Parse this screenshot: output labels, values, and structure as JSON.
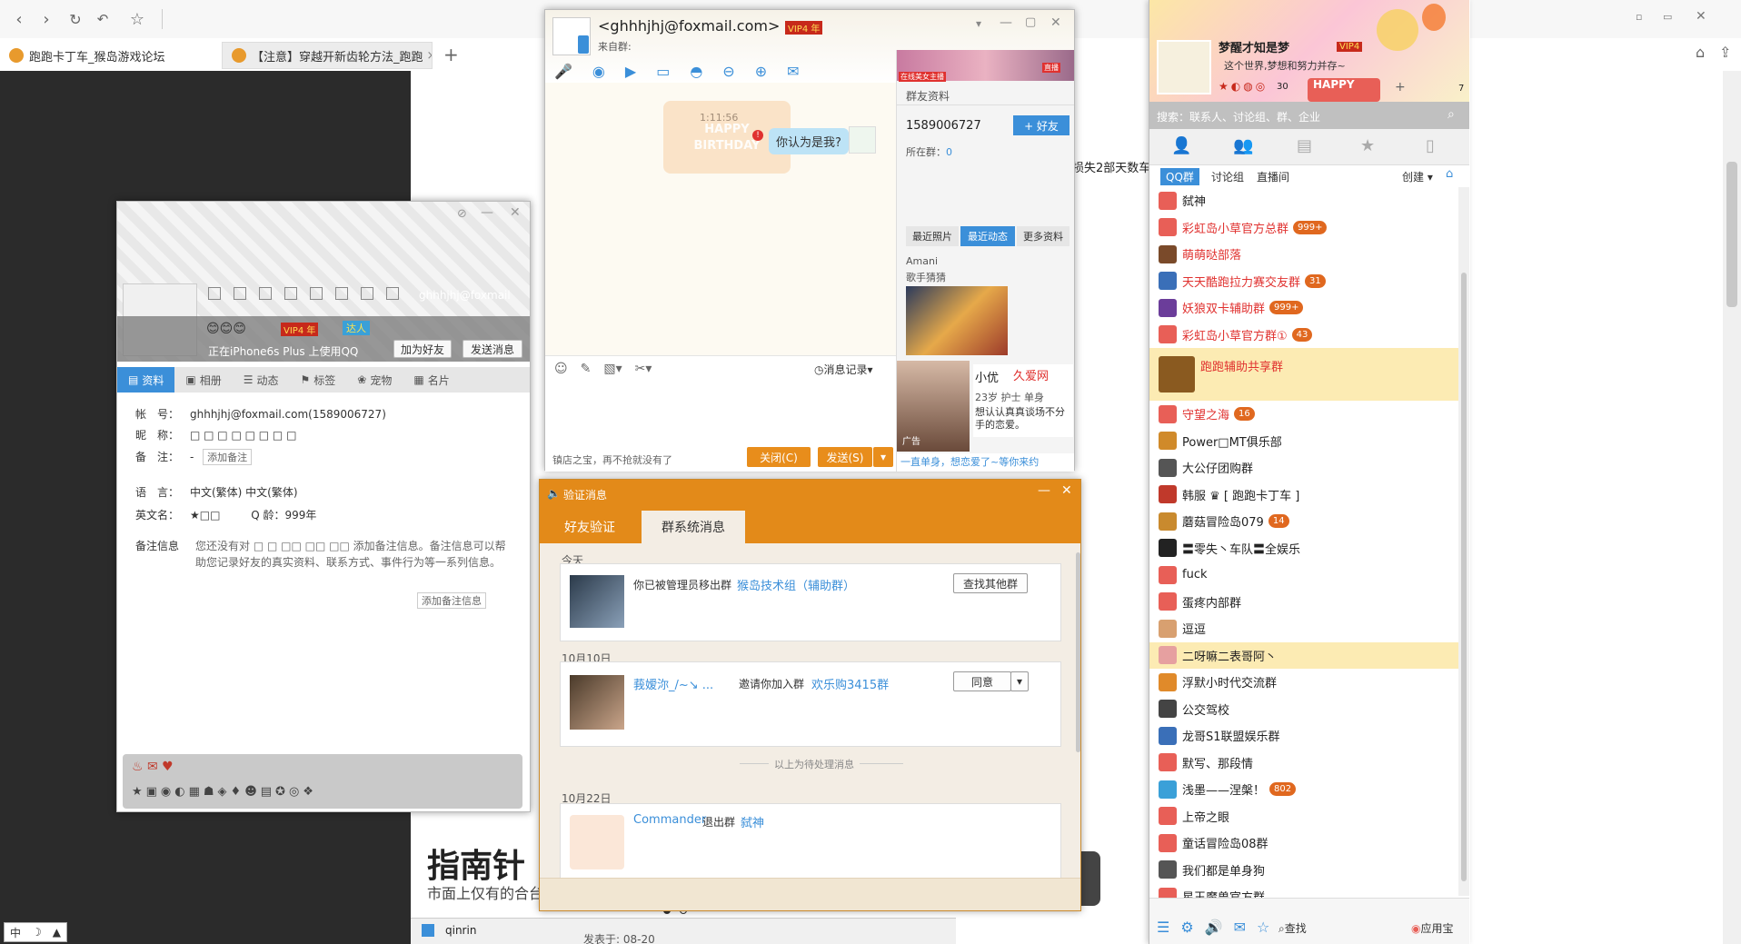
{
  "browser": {
    "tabs": [
      {
        "label": "跑跑卡丁车_猴岛游戏论坛"
      },
      {
        "label": "【注意】穿越开新齿轮方法_跑跑"
      }
    ],
    "new_tab": "+"
  },
  "webpage": {
    "fragment_text": "损失2部天数车",
    "headline": "指南针",
    "subline": "市面上仅有的合台",
    "footer_user": "qinrin",
    "footer_date": "发表于: 08-20"
  },
  "profile": {
    "email_short": "ghhhjhj@foxmail",
    "status": "正在iPhone6s Plus 上使用QQ",
    "vip_badge": "VIP4 年",
    "talent_badge": "达人",
    "add_friend": "加为好友",
    "send_msg": "发送消息",
    "tabs": [
      "资料",
      "相册",
      "动态",
      "标签",
      "宠物",
      "名片"
    ],
    "fields": {
      "account_label": "帐　号：",
      "account_value": "ghhhjhj@foxmail.com(1589006727)",
      "nick_label": "昵　称：",
      "nick_value": "□ □ □ □ □ □ □ □",
      "note_label": "备　注：",
      "note_value": "-",
      "add_note": "添加备注",
      "lang_label": "语　言：",
      "lang_value": "中文(繁体)  中文(繁体)",
      "en_label": "英文名：",
      "en_value": "★□□",
      "qage_label": "Q 龄：",
      "qage_value": "999年",
      "memo_label": "备注信息",
      "memo_text": "您还没有对 □ □ □□ □□ □□ 添加备注信息。备注信息可以帮助您记录好友的真实资料、联系方式、事件行为等一系列信息。",
      "add_memo": "添加备注信息"
    }
  },
  "chat": {
    "title": "<ghhhjhj@foxmail.com>",
    "vip": "VIP4 年",
    "from_group": "来自群:",
    "time": "1:11:56",
    "message": "你认为是我?",
    "history": "消息记录",
    "footer_tip": "镇店之宝，再不抢就没有了",
    "close_btn": "关闭(C)",
    "send_btn": "发送(S)",
    "side_title": "群友资料",
    "qq_number": "1589006727",
    "add_friend": "+ 好友",
    "group_label": "所在群：",
    "group_count": "0",
    "side_tabs": [
      "最近照片",
      "最近动态",
      "更多资料"
    ],
    "poster_name": "Amani",
    "poster_sub": "歌手猜猜",
    "ad_tag": "在线美女主播",
    "ad_name": "小优",
    "ad_brand": "久爱网",
    "ad_info": "23岁 护士 单身",
    "ad_text": "想认认真真谈场不分手的恋爱。",
    "ad_link": "一直单身，想恋爱了~等你来约",
    "ad_label": "广告",
    "ad_live": "直播"
  },
  "verify": {
    "title": "验证消息",
    "tabs": [
      "好友验证",
      "群系统消息"
    ],
    "today": "今天",
    "msg1_text": "你已被管理员移出群",
    "msg1_group": "猴岛技术组（辅助群）",
    "msg1_btn": "查找其他群",
    "date2": "10月10日",
    "msg2_user": "莪嫒沵_/~↘ ...",
    "msg2_text": "邀请你加入群",
    "msg2_group": "欢乐购3415群",
    "msg2_btn": "同意",
    "pending": "以上为待处理消息",
    "date3": "10月22日",
    "msg3_user": "Commander",
    "msg3_text": "退出群",
    "msg3_group": "弑神"
  },
  "qq": {
    "nickname": "梦醒才知是梦",
    "vip": "VIP4",
    "signature": "这个世界,梦想和努力并存~",
    "search_placeholder": "搜索：联系人、讨论组、群、企业",
    "sub_tabs": [
      "QQ群",
      "讨论组",
      "直播间"
    ],
    "create": "创建",
    "level_num": "30",
    "num7": "7",
    "happy": "HAPPY",
    "birthday": "BIRTHDAY",
    "groups": [
      {
        "name": "弑神",
        "badge": "",
        "red": false,
        "color": "#e85f57"
      },
      {
        "name": "彩虹岛小草官方总群",
        "badge": "999+",
        "red": true,
        "color": "#e85f57"
      },
      {
        "name": "萌萌哒部落",
        "badge": "",
        "red": true,
        "color": "#7a4a2a"
      },
      {
        "name": "天天酷跑拉力赛交友群",
        "badge": "31",
        "red": true,
        "color": "#3a6fb8"
      },
      {
        "name": "妖狼双卡辅助群",
        "badge": "999+",
        "red": true,
        "color": "#6b3d9a"
      },
      {
        "name": "彩虹岛小草官方群①",
        "badge": "43",
        "red": true,
        "color": "#e85f57"
      },
      {
        "name": "跑跑辅助共享群",
        "badge": "",
        "red": true,
        "color": "#8a5a20"
      },
      {
        "name": "守望之海",
        "badge": "16",
        "red": true,
        "color": "#e85f57"
      },
      {
        "name": "Power□MT俱乐部",
        "badge": "",
        "red": false,
        "color": "#d08a2a"
      },
      {
        "name": "大公仔团购群",
        "badge": "",
        "red": false,
        "color": "#555"
      },
      {
        "name": "韩服 ♛ [ 跑跑卡丁车 ]",
        "badge": "",
        "red": false,
        "color": "#c0392b"
      },
      {
        "name": "蘑菇冒险岛079",
        "badge": "14",
        "red": false,
        "color": "#c98a2e"
      },
      {
        "name": "〓零失丶车队〓全娱乐",
        "badge": "",
        "red": false,
        "color": "#222"
      },
      {
        "name": "fuck",
        "badge": "",
        "red": false,
        "color": "#e85f57"
      },
      {
        "name": "蛋疼内部群",
        "badge": "",
        "red": false,
        "color": "#e85f57"
      },
      {
        "name": "逗逗",
        "badge": "",
        "red": false,
        "color": "#d8a070"
      },
      {
        "name": "二呀嘛二表哥阿丶",
        "badge": "",
        "red": false,
        "color": "#e6a0a0"
      },
      {
        "name": "浮默小时代交流群",
        "badge": "",
        "red": false,
        "color": "#e08a2a"
      },
      {
        "name": "公交驾校",
        "badge": "",
        "red": false,
        "color": "#444"
      },
      {
        "name": "龙哥S1联盟娱乐群",
        "badge": "",
        "red": false,
        "color": "#3a6fb8"
      },
      {
        "name": "默写、那段情",
        "badge": "",
        "red": false,
        "color": "#e85f57"
      },
      {
        "name": "浅墨——涅槃！",
        "badge": "802",
        "red": false,
        "color": "#3aa0d8"
      },
      {
        "name": "上帝之眼",
        "badge": "",
        "red": false,
        "color": "#e85f57"
      },
      {
        "name": "童话冒险岛08群",
        "badge": "",
        "red": false,
        "color": "#e85f57"
      },
      {
        "name": "我们都是单身狗",
        "badge": "",
        "red": false,
        "color": "#555"
      },
      {
        "name": "星王魔兽官方群",
        "badge": "",
        "red": false,
        "color": "#e85f57"
      }
    ],
    "bottom_find": "查找",
    "bottom_app": "应用宝"
  },
  "ime": {
    "label": "中"
  },
  "colors": {
    "accent": "#3b8fd9",
    "orange": "#e38a19",
    "badge": "#e0681f"
  }
}
